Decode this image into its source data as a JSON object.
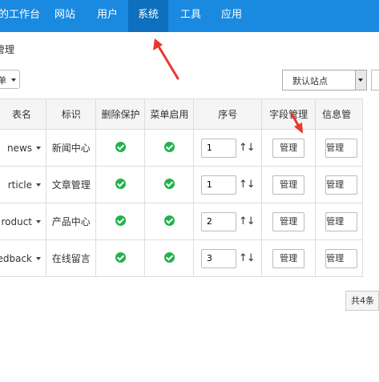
{
  "topnav": {
    "items": [
      {
        "label": "的工作台",
        "active": false
      },
      {
        "label": "网站",
        "active": false
      },
      {
        "label": "用户",
        "active": false
      },
      {
        "label": "系统",
        "active": true
      },
      {
        "label": "工具",
        "active": false
      },
      {
        "label": "应用",
        "active": false
      }
    ]
  },
  "breadcrumb": "管理",
  "filter": {
    "left_select": "单",
    "site_select": "默认站点"
  },
  "table": {
    "headers": [
      "表名",
      "标识",
      "删除保护",
      "菜单启用",
      "序号",
      "字段管理",
      "信息管"
    ],
    "rows": [
      {
        "name": "news",
        "label": "新闻中心",
        "delete_protect": true,
        "menu_enabled": true,
        "seq": "1",
        "field_btn": "管理",
        "info_btn": "管理"
      },
      {
        "name": "rticle",
        "label": "文章管理",
        "delete_protect": true,
        "menu_enabled": true,
        "seq": "1",
        "field_btn": "管理",
        "info_btn": "管理"
      },
      {
        "name": "roduct",
        "label": "产品中心",
        "delete_protect": true,
        "menu_enabled": true,
        "seq": "2",
        "field_btn": "管理",
        "info_btn": "管理"
      },
      {
        "name": "edback",
        "label": "在线留言",
        "delete_protect": true,
        "menu_enabled": true,
        "seq": "3",
        "field_btn": "管理",
        "info_btn": "管理"
      }
    ],
    "sort_arrows": "↑↓"
  },
  "pager": {
    "total": "共4条"
  },
  "colors": {
    "nav_bg": "#1a8ae0",
    "nav_active": "#0d6fbd",
    "check": "#22b24c",
    "annotation": "#e8382f"
  }
}
